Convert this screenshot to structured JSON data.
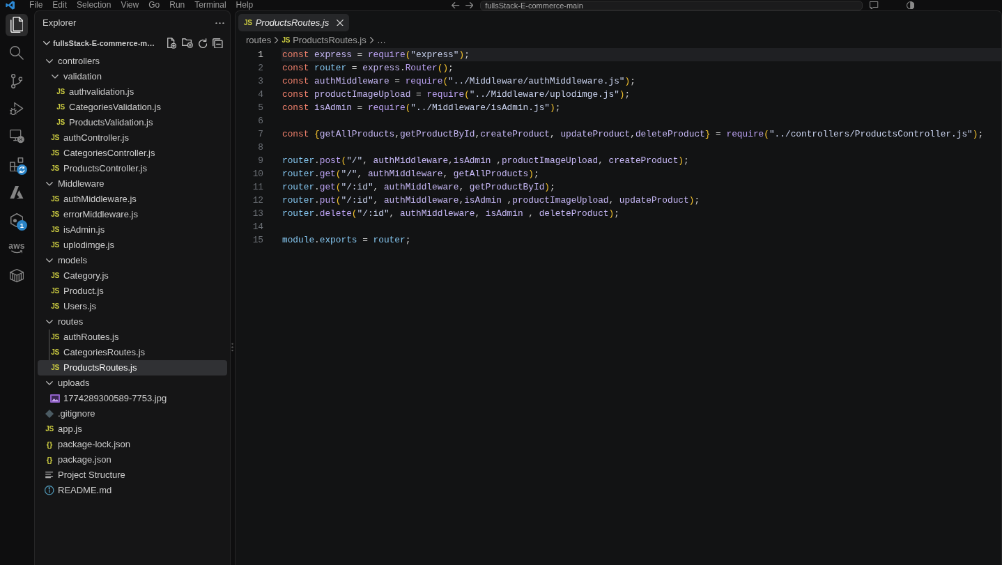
{
  "title_bar": {
    "menu": [
      "File",
      "Edit",
      "Selection",
      "View",
      "Go",
      "Run",
      "Terminal",
      "Help"
    ],
    "command_center": {
      "text": "fullsStack-E-commerce-main"
    }
  },
  "activity_bar": {
    "items": [
      {
        "kind": "explorer",
        "selected": true
      },
      {
        "kind": "search",
        "selected": false
      },
      {
        "kind": "source-control",
        "selected": false
      },
      {
        "kind": "run-debug",
        "selected": false
      },
      {
        "kind": "remote",
        "selected": false
      },
      {
        "kind": "extensions",
        "selected": false
      },
      {
        "kind": "peak",
        "selected": false
      },
      {
        "kind": "hexagon",
        "selected": false,
        "badge": "1"
      },
      {
        "kind": "logo-text",
        "selected": false,
        "label": "aws"
      },
      {
        "kind": "containers",
        "selected": false
      }
    ]
  },
  "sidebar": {
    "title": "Explorer",
    "root": {
      "name": "fullsStack-E-commerce-m…",
      "expanded": true
    },
    "items": [
      {
        "name": "controllers",
        "kind": "folder",
        "expanded": true,
        "selected": false,
        "children": [
          {
            "name": "validation",
            "kind": "folder",
            "expanded": true,
            "selected": false,
            "children": [
              {
                "name": "authvalidation.js",
                "kind": "js",
                "icon_label": "JS",
                "selected": false
              },
              {
                "name": "CategoriesValidation.js",
                "kind": "js",
                "icon_label": "JS",
                "selected": false
              },
              {
                "name": "ProductsValidation.js",
                "kind": "js",
                "icon_label": "JS",
                "selected": false
              }
            ]
          },
          {
            "name": "authController.js",
            "kind": "js",
            "icon_label": "JS",
            "selected": false
          },
          {
            "name": "CategoriesController.js",
            "kind": "js",
            "icon_label": "JS",
            "selected": false
          },
          {
            "name": "ProductsController.js",
            "kind": "js",
            "icon_label": "JS",
            "selected": false
          }
        ]
      },
      {
        "name": "Middleware",
        "kind": "folder",
        "expanded": true,
        "selected": false,
        "children": [
          {
            "name": "authMiddleware.js",
            "kind": "js",
            "icon_label": "JS",
            "selected": false
          },
          {
            "name": "errorMiddleware.js",
            "kind": "js",
            "icon_label": "JS",
            "selected": false
          },
          {
            "name": "isAdmin.js",
            "kind": "js",
            "icon_label": "JS",
            "selected": false
          },
          {
            "name": "uplodimge.js",
            "kind": "js",
            "icon_label": "JS",
            "selected": false
          }
        ]
      },
      {
        "name": "models",
        "kind": "folder",
        "expanded": true,
        "selected": false,
        "children": [
          {
            "name": "Category.js",
            "kind": "js",
            "icon_label": "JS",
            "selected": false
          },
          {
            "name": "Product.js",
            "kind": "js",
            "icon_label": "JS",
            "selected": false
          },
          {
            "name": "Users.js",
            "kind": "js",
            "icon_label": "JS",
            "selected": false
          }
        ]
      },
      {
        "name": "routes",
        "kind": "folder",
        "expanded": true,
        "selected": false,
        "children": [
          {
            "name": "authRoutes.js",
            "kind": "js",
            "icon_label": "JS",
            "selected": false
          },
          {
            "name": "CategoriesRoutes.js",
            "kind": "js",
            "icon_label": "JS",
            "selected": false
          },
          {
            "name": "ProductsRoutes.js",
            "kind": "js",
            "icon_label": "JS",
            "selected": true
          }
        ]
      },
      {
        "name": "uploads",
        "kind": "folder",
        "expanded": true,
        "selected": false,
        "children": [
          {
            "name": "1774289300589-7753.jpg",
            "kind": "image",
            "selected": false
          }
        ]
      },
      {
        "name": ".gitignore",
        "kind": "git",
        "selected": false
      },
      {
        "name": "app.js",
        "kind": "js",
        "icon_label": "JS",
        "selected": false
      },
      {
        "name": "package-lock.json",
        "kind": "json",
        "icon_label": "{}",
        "selected": false
      },
      {
        "name": "package.json",
        "kind": "json",
        "icon_label": "{}",
        "selected": false
      },
      {
        "name": "Project Structure",
        "kind": "text",
        "selected": false
      },
      {
        "name": "README.md",
        "kind": "info",
        "selected": false
      }
    ]
  },
  "editor": {
    "tabs": [
      {
        "label": "ProductsRoutes.js",
        "icon_label": "JS",
        "selected": true,
        "preview": true
      }
    ],
    "breadcrumb": [
      {
        "label": "routes"
      },
      {
        "label": "ProductsRoutes.js",
        "icon_label": "JS"
      },
      {
        "label": "…"
      }
    ],
    "lines": [
      {
        "number": "1",
        "current": true,
        "tokens": [
          {
            "kind": "keyword",
            "text": "const "
          },
          {
            "kind": "variable",
            "text": "express"
          },
          {
            "kind": "plain",
            "text": " = "
          },
          {
            "kind": "function",
            "text": "require"
          },
          {
            "kind": "bracket",
            "text": "("
          },
          {
            "kind": "string",
            "text": "\"express\""
          },
          {
            "kind": "bracket",
            "text": ")"
          },
          {
            "kind": "plain",
            "text": ";"
          }
        ]
      },
      {
        "number": "2",
        "current": false,
        "tokens": [
          {
            "kind": "keyword",
            "text": "const "
          },
          {
            "kind": "object",
            "text": "router"
          },
          {
            "kind": "plain",
            "text": " = "
          },
          {
            "kind": "variable",
            "text": "express"
          },
          {
            "kind": "plain",
            "text": "."
          },
          {
            "kind": "function",
            "text": "Router"
          },
          {
            "kind": "bracket",
            "text": "()"
          },
          {
            "kind": "plain",
            "text": ";"
          }
        ]
      },
      {
        "number": "3",
        "current": false,
        "tokens": [
          {
            "kind": "keyword",
            "text": "const "
          },
          {
            "kind": "variable",
            "text": "authMiddleware"
          },
          {
            "kind": "plain",
            "text": " = "
          },
          {
            "kind": "function",
            "text": "require"
          },
          {
            "kind": "bracket",
            "text": "("
          },
          {
            "kind": "string",
            "text": "\"../Middleware/authMiddleware.js\""
          },
          {
            "kind": "bracket",
            "text": ")"
          },
          {
            "kind": "plain",
            "text": ";"
          }
        ]
      },
      {
        "number": "4",
        "current": false,
        "tokens": [
          {
            "kind": "keyword",
            "text": "const "
          },
          {
            "kind": "variable",
            "text": "productImageUpload"
          },
          {
            "kind": "plain",
            "text": " = "
          },
          {
            "kind": "function",
            "text": "require"
          },
          {
            "kind": "bracket",
            "text": "("
          },
          {
            "kind": "string",
            "text": "\"../Middleware/uplodimge.js\""
          },
          {
            "kind": "bracket",
            "text": ")"
          },
          {
            "kind": "plain",
            "text": ";"
          }
        ]
      },
      {
        "number": "5",
        "current": false,
        "tokens": [
          {
            "kind": "keyword",
            "text": "const "
          },
          {
            "kind": "variable",
            "text": "isAdmin"
          },
          {
            "kind": "plain",
            "text": " = "
          },
          {
            "kind": "function",
            "text": "require"
          },
          {
            "kind": "bracket",
            "text": "("
          },
          {
            "kind": "string",
            "text": "\"../Middleware/isAdmin.js\""
          },
          {
            "kind": "bracket",
            "text": ")"
          },
          {
            "kind": "plain",
            "text": ";"
          }
        ]
      },
      {
        "number": "6",
        "current": false
      },
      {
        "number": "7",
        "current": false,
        "tokens": [
          {
            "kind": "keyword",
            "text": "const "
          },
          {
            "kind": "bracket",
            "text": "{"
          },
          {
            "kind": "variable",
            "text": "getAllProducts"
          },
          {
            "kind": "plain",
            "text": ","
          },
          {
            "kind": "variable",
            "text": "getProductById"
          },
          {
            "kind": "plain",
            "text": ","
          },
          {
            "kind": "variable",
            "text": "createProduct"
          },
          {
            "kind": "plain",
            "text": ", "
          },
          {
            "kind": "variable",
            "text": "updateProduct"
          },
          {
            "kind": "plain",
            "text": ","
          },
          {
            "kind": "variable",
            "text": "deleteProduct"
          },
          {
            "kind": "bracket",
            "text": "}"
          },
          {
            "kind": "plain",
            "text": " = "
          },
          {
            "kind": "function",
            "text": "require"
          },
          {
            "kind": "bracket",
            "text": "("
          },
          {
            "kind": "string",
            "text": "\"../controllers/ProductsController.js\""
          },
          {
            "kind": "bracket",
            "text": ")"
          },
          {
            "kind": "plain",
            "text": ";"
          }
        ]
      },
      {
        "number": "8",
        "current": false
      },
      {
        "number": "9",
        "current": false,
        "tokens": [
          {
            "kind": "object",
            "text": "router"
          },
          {
            "kind": "plain",
            "text": "."
          },
          {
            "kind": "function",
            "text": "post"
          },
          {
            "kind": "bracket",
            "text": "("
          },
          {
            "kind": "string",
            "text": "\"/\""
          },
          {
            "kind": "plain",
            "text": ", "
          },
          {
            "kind": "variable",
            "text": "authMiddleware"
          },
          {
            "kind": "plain",
            "text": ","
          },
          {
            "kind": "variable",
            "text": "isAdmin"
          },
          {
            "kind": "plain",
            "text": " ,"
          },
          {
            "kind": "variable",
            "text": "productImageUpload"
          },
          {
            "kind": "plain",
            "text": ", "
          },
          {
            "kind": "variable",
            "text": "createProduct"
          },
          {
            "kind": "bracket",
            "text": ")"
          },
          {
            "kind": "plain",
            "text": ";"
          }
        ]
      },
      {
        "number": "10",
        "current": false,
        "tokens": [
          {
            "kind": "object",
            "text": "router"
          },
          {
            "kind": "plain",
            "text": "."
          },
          {
            "kind": "function",
            "text": "get"
          },
          {
            "kind": "bracket",
            "text": "("
          },
          {
            "kind": "string",
            "text": "\"/\""
          },
          {
            "kind": "plain",
            "text": ", "
          },
          {
            "kind": "variable",
            "text": "authMiddleware"
          },
          {
            "kind": "plain",
            "text": ", "
          },
          {
            "kind": "variable",
            "text": "getAllProducts"
          },
          {
            "kind": "bracket",
            "text": ")"
          },
          {
            "kind": "plain",
            "text": ";"
          }
        ]
      },
      {
        "number": "11",
        "current": false,
        "tokens": [
          {
            "kind": "object",
            "text": "router"
          },
          {
            "kind": "plain",
            "text": "."
          },
          {
            "kind": "function",
            "text": "get"
          },
          {
            "kind": "bracket",
            "text": "("
          },
          {
            "kind": "string",
            "text": "\"/:id\""
          },
          {
            "kind": "plain",
            "text": ", "
          },
          {
            "kind": "variable",
            "text": "authMiddleware"
          },
          {
            "kind": "plain",
            "text": ", "
          },
          {
            "kind": "variable",
            "text": "getProductById"
          },
          {
            "kind": "bracket",
            "text": ")"
          },
          {
            "kind": "plain",
            "text": ";"
          }
        ]
      },
      {
        "number": "12",
        "current": false,
        "tokens": [
          {
            "kind": "object",
            "text": "router"
          },
          {
            "kind": "plain",
            "text": "."
          },
          {
            "kind": "function",
            "text": "put"
          },
          {
            "kind": "bracket",
            "text": "("
          },
          {
            "kind": "string",
            "text": "\"/:id\""
          },
          {
            "kind": "plain",
            "text": ", "
          },
          {
            "kind": "variable",
            "text": "authMiddleware"
          },
          {
            "kind": "plain",
            "text": ","
          },
          {
            "kind": "variable",
            "text": "isAdmin"
          },
          {
            "kind": "plain",
            "text": " ,"
          },
          {
            "kind": "variable",
            "text": "productImageUpload"
          },
          {
            "kind": "plain",
            "text": ", "
          },
          {
            "kind": "variable",
            "text": "updateProduct"
          },
          {
            "kind": "bracket",
            "text": ")"
          },
          {
            "kind": "plain",
            "text": ";"
          }
        ]
      },
      {
        "number": "13",
        "current": false,
        "tokens": [
          {
            "kind": "object",
            "text": "router"
          },
          {
            "kind": "plain",
            "text": "."
          },
          {
            "kind": "function",
            "text": "delete"
          },
          {
            "kind": "bracket",
            "text": "("
          },
          {
            "kind": "string",
            "text": "\"/:id\""
          },
          {
            "kind": "plain",
            "text": ", "
          },
          {
            "kind": "variable",
            "text": "authMiddleware"
          },
          {
            "kind": "plain",
            "text": ", "
          },
          {
            "kind": "variable",
            "text": "isAdmin"
          },
          {
            "kind": "plain",
            "text": " , "
          },
          {
            "kind": "variable",
            "text": "deleteProduct"
          },
          {
            "kind": "bracket",
            "text": ")"
          },
          {
            "kind": "plain",
            "text": ";"
          }
        ]
      },
      {
        "number": "14",
        "current": false
      },
      {
        "number": "15",
        "current": false,
        "tokens": [
          {
            "kind": "object",
            "text": "module"
          },
          {
            "kind": "plain",
            "text": "."
          },
          {
            "kind": "object",
            "text": "exports"
          },
          {
            "kind": "plain",
            "text": " = "
          },
          {
            "kind": "object",
            "text": "router"
          },
          {
            "kind": "plain",
            "text": ";"
          }
        ]
      }
    ]
  }
}
